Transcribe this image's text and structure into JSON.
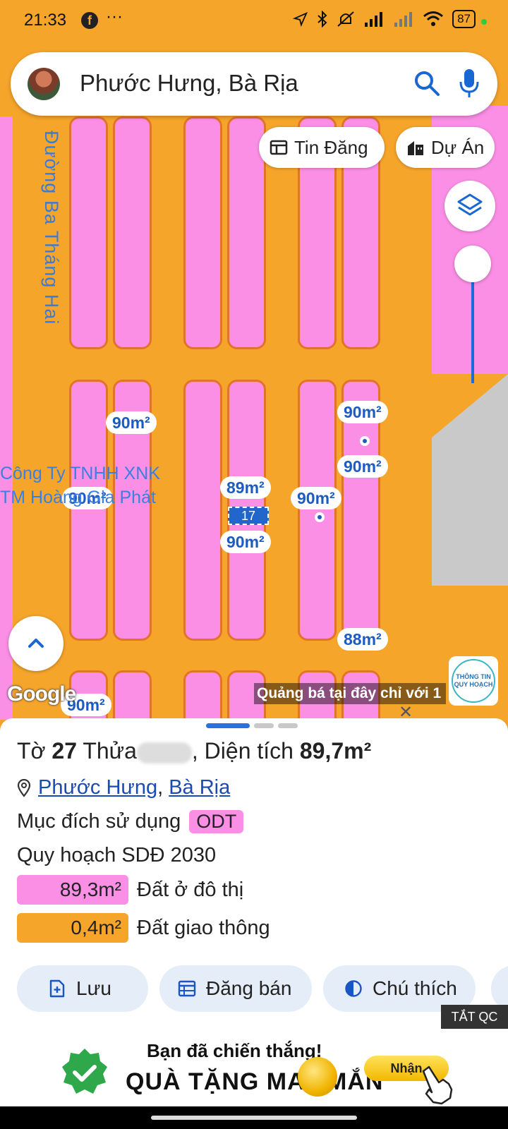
{
  "status_bar": {
    "time": "21:33",
    "fb": "f",
    "more": "···",
    "battery": "87"
  },
  "search": {
    "text": "Phước Hưng, Bà Rịa"
  },
  "chips": {
    "tin_dang": "Tin Đăng",
    "du_an": "Dự Án"
  },
  "map": {
    "road_name": "Đường Ba Tháng Hai",
    "poi_line1": "Công Ty TNHH XNK",
    "poi_line2": "TM Hoàng Gia Phát",
    "selected_marker": "17",
    "area_tags": [
      "90m²",
      "90m²",
      "90m²",
      "89m²",
      "90m²",
      "90m²",
      "88m²",
      "90m²",
      "90m²"
    ],
    "google": "Google",
    "ticker": "Quảng bá tại đây chỉ với 1",
    "badge_line1": "THÔNG TIN",
    "badge_line2": "QUY HOẠCH",
    "close": "✕"
  },
  "sheet": {
    "to_label": "Tờ",
    "to_value": "27",
    "thua_label": "Thửa",
    "area_label": ", Diện tích",
    "area_value": "89,7m²",
    "ward": "Phước Hưng",
    "city": "Bà Rịa",
    "purpose_label": "Mục đích sử dụng",
    "purpose_code": "ODT",
    "plan": "Quy hoạch SDĐ 2030",
    "legend": [
      {
        "value": "89,3m²",
        "label": "Đất ở đô thị",
        "color": "#fb8fe6"
      },
      {
        "value": "0,4m²",
        "label": "Đất giao thông",
        "color": "#f6a52b"
      }
    ],
    "actions": {
      "save": "Lưu",
      "post": "Đăng bán",
      "legend": "Chú thích"
    },
    "tat_qc": "TẮT QC"
  },
  "ad": {
    "line1": "Bạn đã chiến thắng!",
    "line2": "QUÀ TẶNG MAY MẮN",
    "button": "Nhận"
  }
}
